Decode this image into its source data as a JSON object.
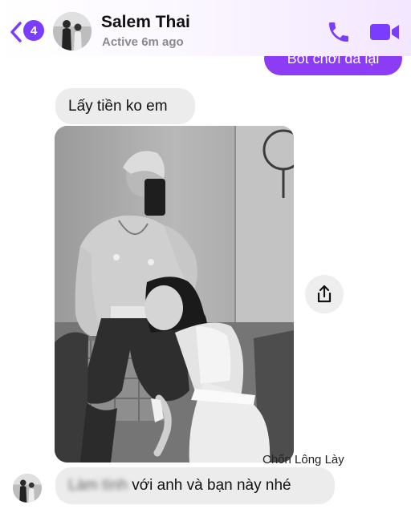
{
  "header": {
    "back_badge_count": "4",
    "contact_name": "Salem Thai",
    "contact_status": "Active 6m ago",
    "icons": {
      "back": "chevron-left-icon",
      "call": "phone-icon",
      "video": "video-camera-icon"
    }
  },
  "messages": {
    "sent_partial": "Bốt chơi đã lại",
    "received_1": "Lấy tiền ko em",
    "received_2_blurred": "Làm tình",
    "received_2_rest": "với anh và bạn này nhé"
  },
  "overlay": {
    "watermark": "Chốn Lông Lày"
  },
  "colors": {
    "accent": "#8b3cf4",
    "badge": "#7a3cff",
    "received_bubble": "#ececec"
  }
}
